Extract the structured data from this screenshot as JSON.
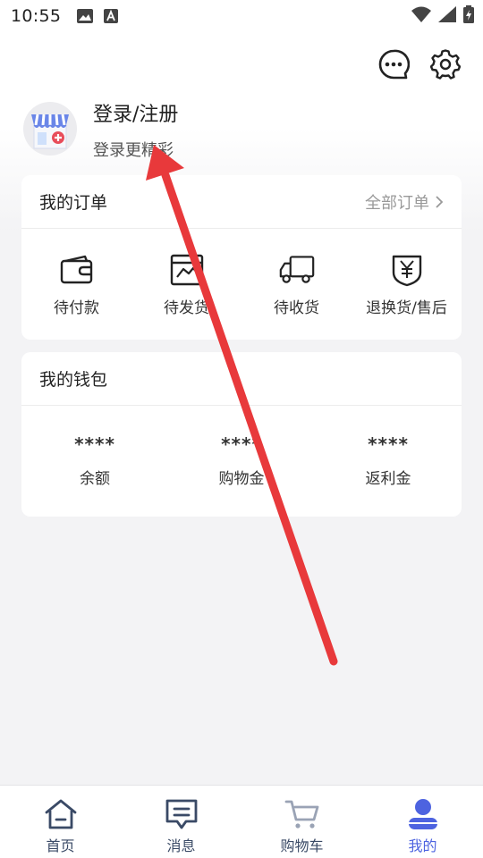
{
  "status_bar": {
    "time": "10:55"
  },
  "profile": {
    "title": "登录/注册",
    "subtitle": "登录更精彩"
  },
  "orders": {
    "title": "我的订单",
    "all_link": "全部订单",
    "items": [
      {
        "label": "待付款",
        "icon": "wallet-icon"
      },
      {
        "label": "待发货",
        "icon": "package-icon"
      },
      {
        "label": "待收货",
        "icon": "truck-icon"
      },
      {
        "label": "退换货/售后",
        "icon": "refund-icon"
      }
    ]
  },
  "wallet": {
    "title": "我的钱包",
    "items": [
      {
        "value": "****",
        "label": "余额"
      },
      {
        "value": "****",
        "label": "购物金"
      },
      {
        "value": "****",
        "label": "返利金"
      }
    ]
  },
  "tabbar": {
    "items": [
      {
        "label": "首页",
        "icon": "home-icon"
      },
      {
        "label": "消息",
        "icon": "message-icon"
      },
      {
        "label": "购物车",
        "icon": "cart-icon"
      },
      {
        "label": "我的",
        "icon": "user-icon",
        "active": true
      }
    ]
  },
  "colors": {
    "accent": "#4d63e0",
    "annotation_arrow": "#e8393b",
    "icon_dark": "#3a4a66"
  }
}
